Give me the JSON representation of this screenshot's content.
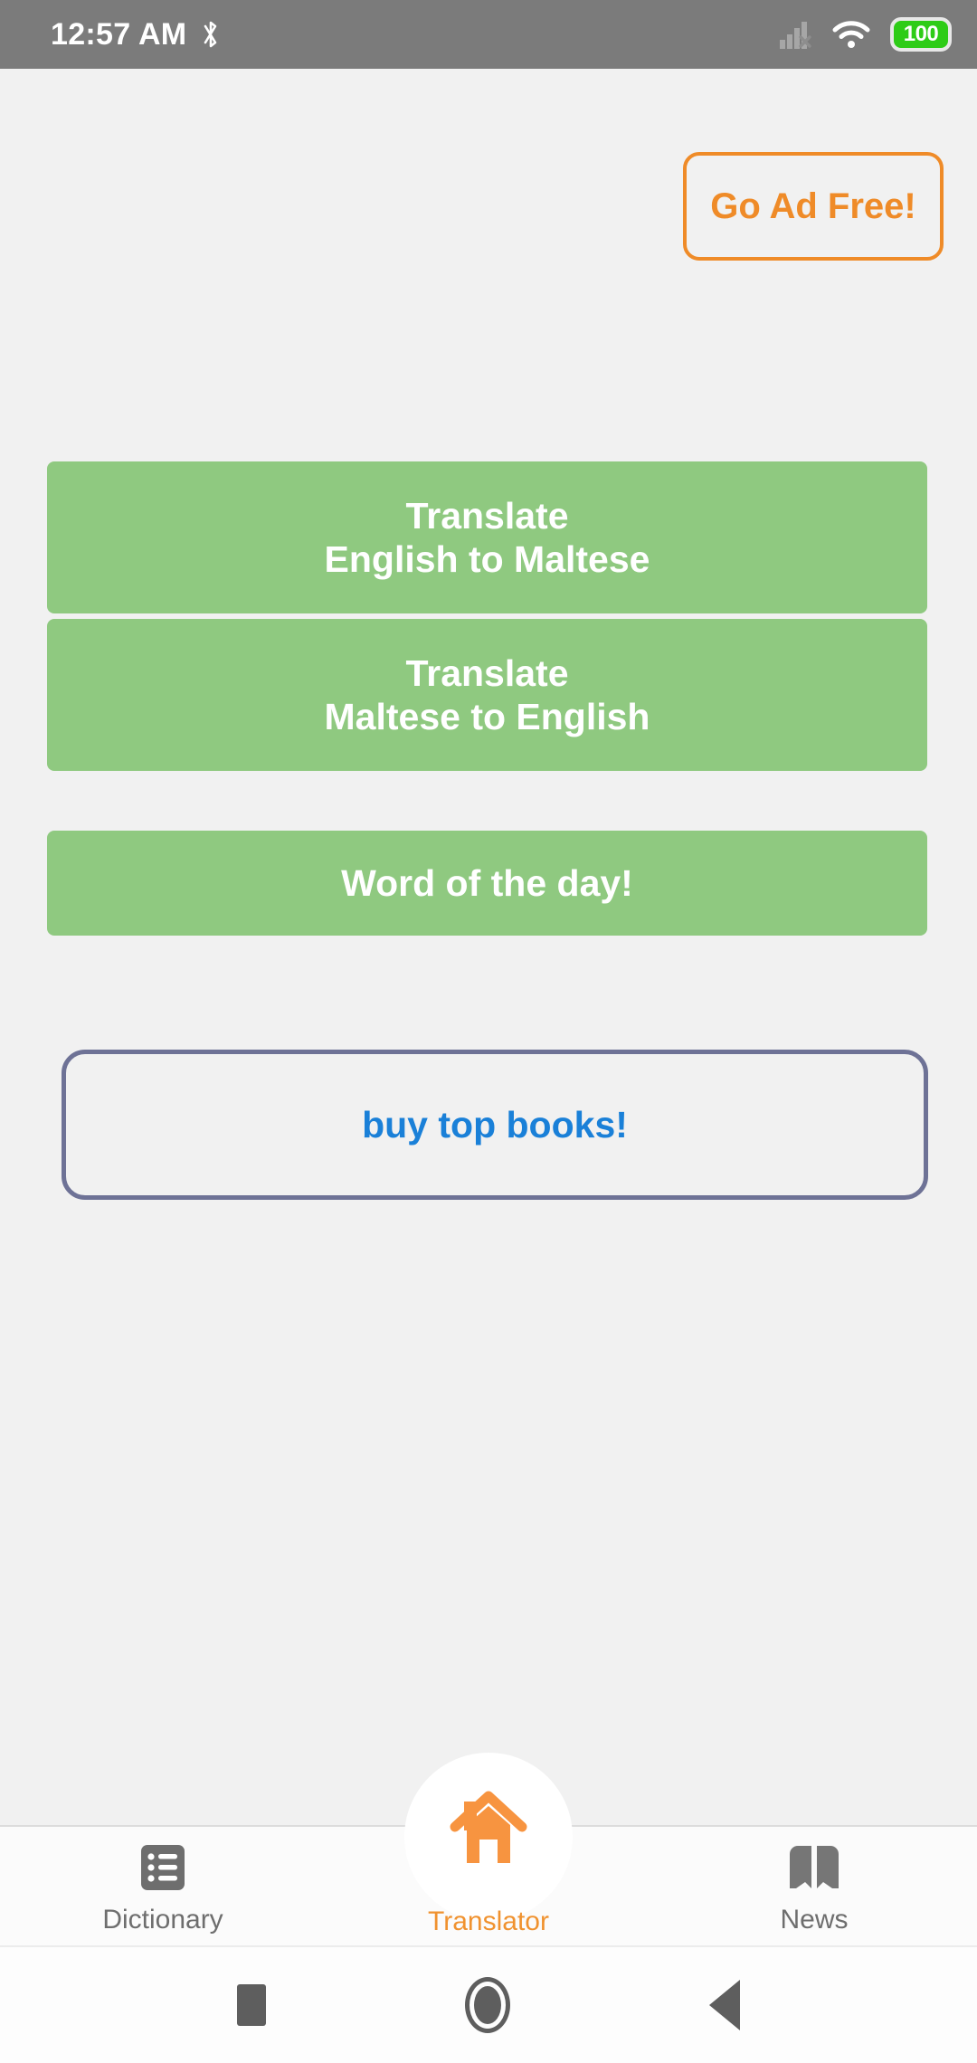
{
  "status_bar": {
    "time": "12:57 AM",
    "bluetooth_icon": "bluetooth-icon",
    "signal_icon": "signal-no-service-icon",
    "wifi_icon": "wifi-icon",
    "battery_level": "100",
    "battery_color": "#2ecc17",
    "background_color": "#7b7b7b"
  },
  "header": {
    "go_ad_free_label": "Go Ad Free!",
    "go_ad_free_color": "#ef8b28"
  },
  "main": {
    "background_color": "#f1f1f1",
    "buttons": [
      {
        "name": "translate-english-to-maltese",
        "line1": "Translate",
        "line2": "English to Maltese",
        "color": "#8fc980",
        "text_color": "#ffffff"
      },
      {
        "name": "translate-maltese-to-english",
        "line1": "Translate",
        "line2": "Maltese to English",
        "color": "#8fc980",
        "text_color": "#ffffff"
      },
      {
        "name": "word-of-the-day",
        "line1": "Word of the day!",
        "line2": "",
        "color": "#8fc980",
        "text_color": "#ffffff"
      }
    ],
    "buy_books": {
      "label": "buy top books!",
      "text_color": "#1a80d8",
      "border_color": "#6e7296"
    }
  },
  "bottom_nav": {
    "items": [
      {
        "label": "Dictionary",
        "icon": "list-icon",
        "active": false,
        "color": "#6e6e6e"
      },
      {
        "label": "Translator",
        "icon": "home-icon",
        "active": true,
        "color": "#f0922f"
      },
      {
        "label": "News",
        "icon": "book-icon",
        "active": false,
        "color": "#6e6e6e"
      }
    ]
  },
  "system_nav": {
    "recents_label": "recents-button",
    "home_label": "home-button",
    "back_label": "back-button"
  }
}
